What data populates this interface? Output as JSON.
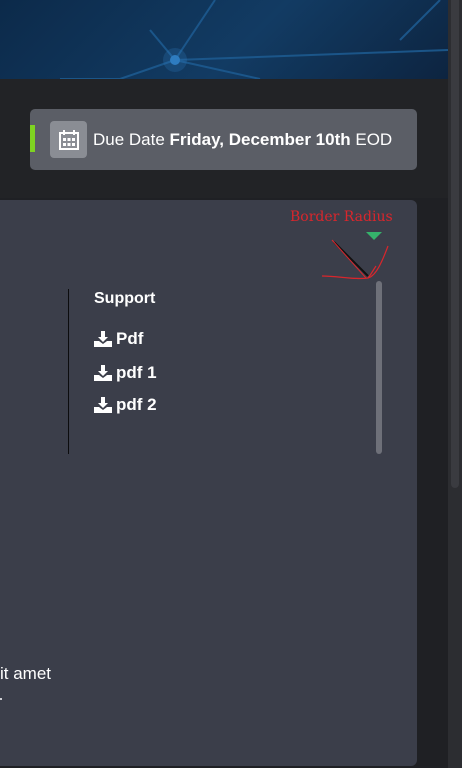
{
  "due": {
    "label": "Due Date ",
    "date": "Friday, December 10th",
    "suffix": " EOD"
  },
  "support": {
    "title": "Support",
    "downloads": [
      {
        "label": "Pdf"
      },
      {
        "label": "pdf 1"
      },
      {
        "label": "pdf 2"
      }
    ]
  },
  "annotation": {
    "text": "Border Radius"
  },
  "body_text": {
    "line": "it amet"
  },
  "colors": {
    "accent": "#7ed321",
    "annotation": "#d9262c",
    "marker": "#35b36b"
  }
}
